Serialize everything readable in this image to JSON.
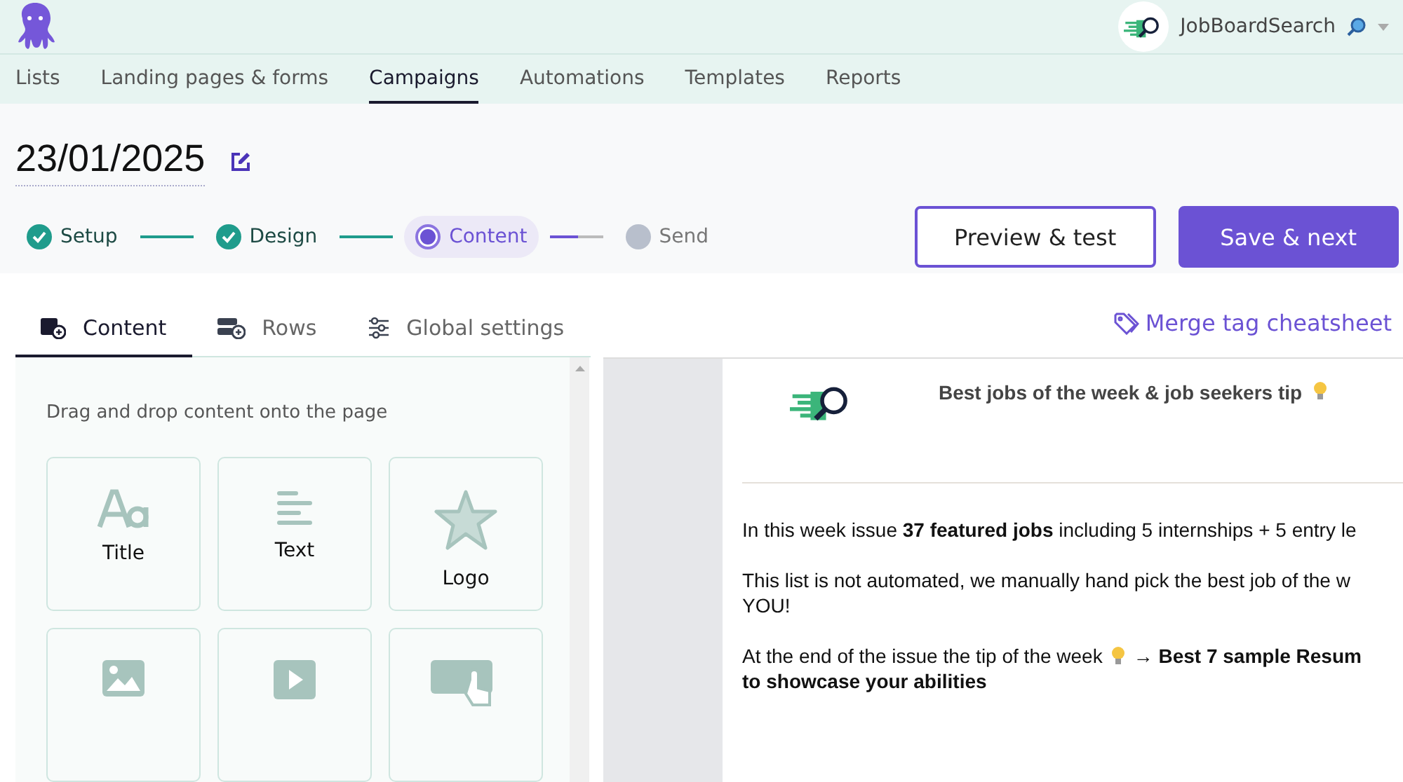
{
  "account": {
    "name": "JobBoardSearch"
  },
  "nav": [
    {
      "label": "Lists",
      "selected": false
    },
    {
      "label": "Landing pages & forms",
      "selected": false
    },
    {
      "label": "Campaigns",
      "selected": true
    },
    {
      "label": "Automations",
      "selected": false
    },
    {
      "label": "Templates",
      "selected": false
    },
    {
      "label": "Reports",
      "selected": false
    }
  ],
  "campaign_title": "23/01/2025",
  "steps": [
    {
      "label": "Setup",
      "kind": "done"
    },
    {
      "label": "Design",
      "kind": "done"
    },
    {
      "label": "Content",
      "kind": "current"
    },
    {
      "label": "Send",
      "kind": "pending"
    }
  ],
  "buttons": [
    {
      "label": "Preview & test",
      "kind": "outline"
    },
    {
      "label": "Save & next",
      "kind": "primary"
    }
  ],
  "editor_tabs": [
    {
      "label": "Content",
      "kind": "content",
      "selected": true
    },
    {
      "label": "Rows",
      "kind": "rows",
      "selected": false
    },
    {
      "label": "Global settings",
      "kind": "settings",
      "selected": false
    }
  ],
  "merge_link": "Merge tag cheatsheet",
  "hint": "Drag and drop content onto the page",
  "blocks": [
    {
      "label": "Title",
      "kind": "title"
    },
    {
      "label": "Text",
      "kind": "text"
    },
    {
      "label": "Logo",
      "kind": "logo"
    },
    {
      "kind": "image"
    },
    {
      "kind": "video"
    },
    {
      "kind": "button"
    }
  ],
  "email": {
    "heading": "Best jobs of the week & job seekers tip",
    "paragraphs": [
      {
        "lines": [
          [
            "In this week issue **37 featured jobs** including 5 internships + 5 entry le"
          ]
        ]
      },
      {
        "lines": [
          [
            "This list is not automated, we manually hand pick the best job of the w"
          ],
          [
            "YOU!"
          ]
        ]
      },
      {
        "lines": [
          [
            "At the end of the issue the tip of the week",
            "→ **Best 7 sample Resum**"
          ],
          [
            "**to showcase your abilities**"
          ]
        ]
      }
    ]
  }
}
